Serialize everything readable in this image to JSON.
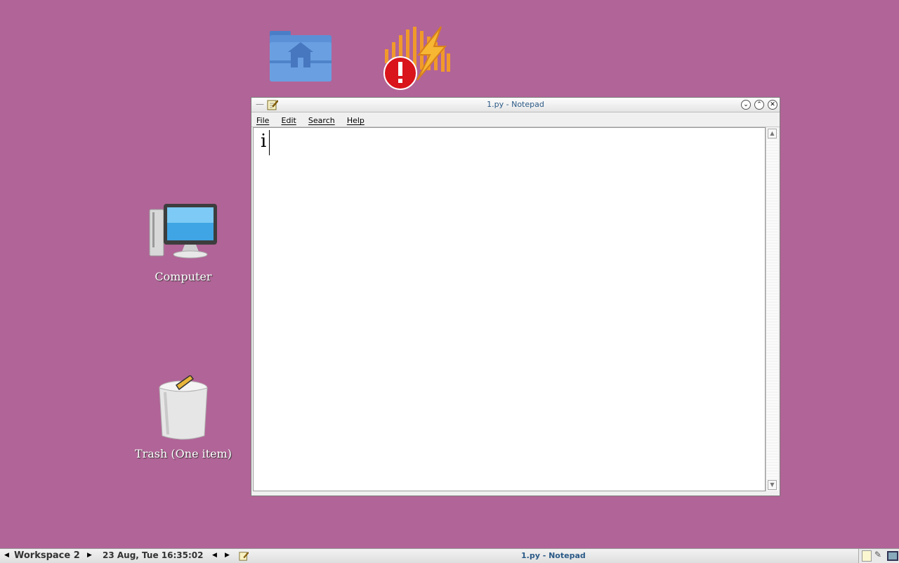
{
  "desktop": {
    "icons": [
      {
        "name": "home-folder",
        "label": ""
      },
      {
        "name": "app-error-launcher",
        "label": ""
      },
      {
        "name": "computer",
        "label": "Computer"
      },
      {
        "name": "trash",
        "label": "Trash (One item)"
      }
    ],
    "background_color": "#b16497"
  },
  "window": {
    "title": "1.py - Notepad",
    "menu": [
      "File",
      "Edit",
      "Search",
      "Help"
    ],
    "editor_content": "i"
  },
  "taskbar": {
    "workspace": "Workspace 2",
    "datetime": "23 Aug, Tue 16:35:02",
    "active_task": "1.py - Notepad"
  }
}
